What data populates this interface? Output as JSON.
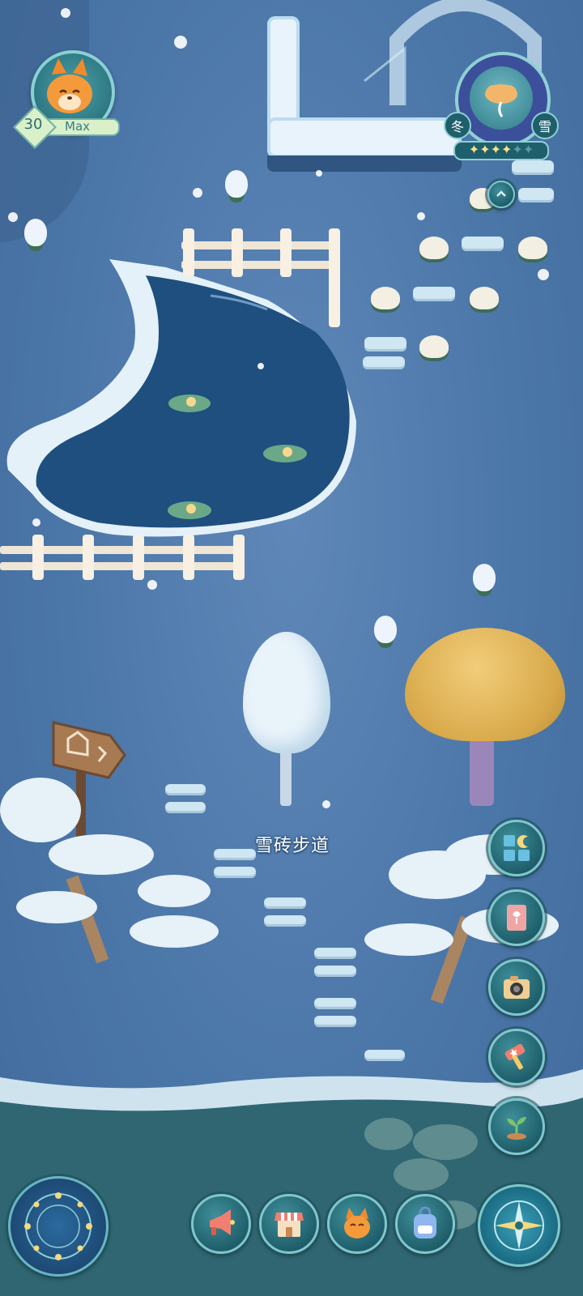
{
  "player": {
    "level": "30",
    "name": "Max",
    "avatar_icon": "fox-avatar-icon"
  },
  "season": {
    "left_label": "冬",
    "right_label": "雪",
    "stars_filled": 4,
    "stars_total": 6,
    "weather_icon": "cloud-weather-icon"
  },
  "area_label": "雪砖步道",
  "side_buttons": [
    {
      "name": "menu-grid-button",
      "icon": "grid-moon-icon"
    },
    {
      "name": "codex-book-button",
      "icon": "tulip-book-icon"
    },
    {
      "name": "camera-button",
      "icon": "camera-icon"
    },
    {
      "name": "hammer-button",
      "icon": "hammer-star-icon"
    },
    {
      "name": "sprout-button",
      "icon": "sprout-icon"
    }
  ],
  "bottom_buttons": [
    {
      "name": "announcement-button",
      "icon": "megaphone-icon"
    },
    {
      "name": "shop-button",
      "icon": "store-icon"
    },
    {
      "name": "pet-button",
      "icon": "fox-face-icon"
    },
    {
      "name": "backpack-button",
      "icon": "backpack-icon"
    }
  ],
  "colors": {
    "ground": "#4b76a8",
    "pond": "#1e4f7e",
    "panel_teal": "#1f5f6b",
    "accent_gold": "#f7e08a"
  }
}
